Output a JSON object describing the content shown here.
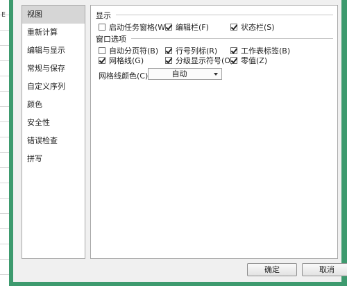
{
  "sheet": {
    "column_letter": "E"
  },
  "sidebar": {
    "items": [
      {
        "label": "视图",
        "selected": true
      },
      {
        "label": "重新计算",
        "selected": false
      },
      {
        "label": "编辑与显示",
        "selected": false
      },
      {
        "label": "常规与保存",
        "selected": false
      },
      {
        "label": "自定义序列",
        "selected": false
      },
      {
        "label": "颜色",
        "selected": false
      },
      {
        "label": "安全性",
        "selected": false
      },
      {
        "label": "错误检查",
        "selected": false
      },
      {
        "label": "拼写",
        "selected": false
      }
    ]
  },
  "display_group": {
    "title": "显示",
    "options": [
      {
        "label": "启动任务窗格(W)",
        "checked": false
      },
      {
        "label": "编辑栏(F)",
        "checked": true
      },
      {
        "label": "状态栏(S)",
        "checked": true
      }
    ]
  },
  "window_group": {
    "title": "窗口选项",
    "options": [
      {
        "label": "自动分页符(B)",
        "checked": false
      },
      {
        "label": "行号列标(R)",
        "checked": true
      },
      {
        "label": "工作表标签(B)",
        "checked": true
      },
      {
        "label": "网格线(G)",
        "checked": true
      },
      {
        "label": "分级显示符号(O)",
        "checked": true
      },
      {
        "label": "零值(Z)",
        "checked": true
      }
    ]
  },
  "gridline_color": {
    "label": "网格线颜色(C):",
    "value": "自动"
  },
  "buttons": {
    "ok": "确定",
    "cancel": "取消"
  },
  "colors": {
    "border_green": "#3d9a6e",
    "selection": "#d6d6d6"
  }
}
